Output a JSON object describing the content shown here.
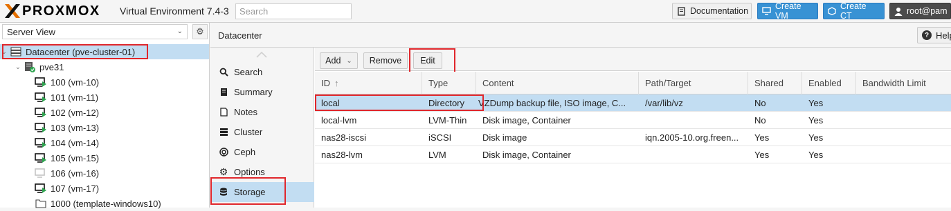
{
  "header": {
    "brand": "PROXMOX",
    "version": "Virtual Environment 7.4-3",
    "search_placeholder": "Search",
    "documentation_label": "Documentation",
    "create_vm_label": "Create VM",
    "create_ct_label": "Create CT",
    "user_label": "root@pam"
  },
  "tree": {
    "view_selector": "Server View",
    "datacenter": "Datacenter (pve-cluster-01)",
    "node": "pve31",
    "guests": [
      {
        "label": "100 (vm-10)",
        "status": "running"
      },
      {
        "label": "101 (vm-11)",
        "status": "running"
      },
      {
        "label": "102 (vm-12)",
        "status": "running"
      },
      {
        "label": "103 (vm-13)",
        "status": "running"
      },
      {
        "label": "104 (vm-14)",
        "status": "running"
      },
      {
        "label": "105 (vm-15)",
        "status": "running"
      },
      {
        "label": "106 (vm-16)",
        "status": "stopped"
      },
      {
        "label": "107 (vm-17)",
        "status": "running"
      },
      {
        "label": "1000 (template-windows10)",
        "status": "template"
      }
    ]
  },
  "content": {
    "title": "Datacenter",
    "help_label": "Help"
  },
  "nav": {
    "items": [
      {
        "label": "Search",
        "icon": "search-icon"
      },
      {
        "label": "Summary",
        "icon": "book-icon"
      },
      {
        "label": "Notes",
        "icon": "notes-icon"
      },
      {
        "label": "Cluster",
        "icon": "server-icon"
      },
      {
        "label": "Ceph",
        "icon": "ceph-icon"
      },
      {
        "label": "Options",
        "icon": "gear-icon"
      },
      {
        "label": "Storage",
        "icon": "database-icon"
      }
    ],
    "selected": "Storage"
  },
  "toolbar": {
    "add_label": "Add",
    "remove_label": "Remove",
    "edit_label": "Edit"
  },
  "storage_table": {
    "columns": [
      "ID",
      "Type",
      "Content",
      "Path/Target",
      "Shared",
      "Enabled",
      "Bandwidth Limit"
    ],
    "rows": [
      {
        "id": "local",
        "type": "Directory",
        "content": "VZDump backup file, ISO image, C...",
        "path": "/var/lib/vz",
        "shared": "No",
        "enabled": "Yes",
        "bw": ""
      },
      {
        "id": "local-lvm",
        "type": "LVM-Thin",
        "content": "Disk image, Container",
        "path": "",
        "shared": "No",
        "enabled": "Yes",
        "bw": ""
      },
      {
        "id": "nas28-iscsi",
        "type": "iSCSI",
        "content": "Disk image",
        "path": "iqn.2005-10.org.freen...",
        "shared": "Yes",
        "enabled": "Yes",
        "bw": ""
      },
      {
        "id": "nas28-lvm",
        "type": "LVM",
        "content": "Disk image, Container",
        "path": "",
        "shared": "Yes",
        "enabled": "Yes",
        "bw": ""
      }
    ],
    "selected_row": "local"
  },
  "colors": {
    "accent": "#3892d4",
    "selection": "#c2ddf2",
    "highlight": "#e0262b",
    "logo_orange": "#e57000"
  }
}
